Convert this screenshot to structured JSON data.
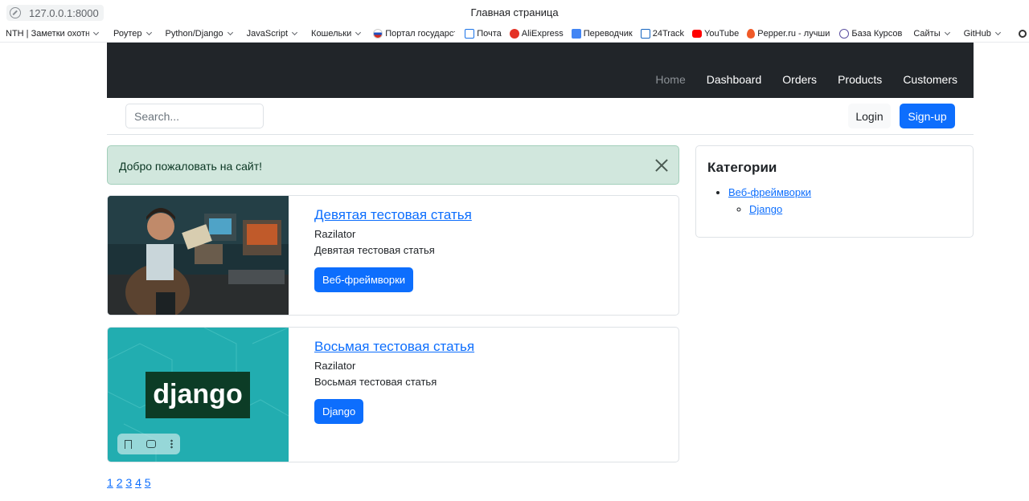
{
  "browser": {
    "address": "127.0.0.1:8000",
    "window_title": "Главная страница",
    "bookmarks": [
      {
        "label": "NTH | Заметки охотн",
        "dropdown": true,
        "color": ""
      },
      {
        "label": "Роутер",
        "dropdown": true,
        "color": ""
      },
      {
        "label": "Python/Django",
        "dropdown": true,
        "color": ""
      },
      {
        "label": "JavaScript",
        "dropdown": true,
        "color": ""
      },
      {
        "label": "Кошельки",
        "dropdown": true,
        "color": ""
      },
      {
        "label": "Портал государст",
        "dropdown": false,
        "color": "#1f4fbf"
      },
      {
        "label": "Почта",
        "dropdown": false,
        "color": "#1a73e8"
      },
      {
        "label": "AliExpress",
        "dropdown": false,
        "color": "#e43225"
      },
      {
        "label": "Переводчик",
        "dropdown": false,
        "color": "#4285f4"
      },
      {
        "label": "24Track",
        "dropdown": false,
        "color": "#1565c0"
      },
      {
        "label": "YouTube",
        "dropdown": false,
        "color": "#ff0000"
      },
      {
        "label": "Pepper.ru - лучши",
        "dropdown": false,
        "color": "#f05a28"
      },
      {
        "label": "База Курсов",
        "dropdown": false,
        "color": "#5b4fa0"
      },
      {
        "label": "Сайты",
        "dropdown": true,
        "color": ""
      },
      {
        "label": "GitHub",
        "dropdown": true,
        "color": ""
      }
    ]
  },
  "navbar": {
    "links": [
      "Home",
      "Dashboard",
      "Orders",
      "Products",
      "Customers"
    ],
    "bg_color": "#212529"
  },
  "search": {
    "placeholder": "Search..."
  },
  "auth": {
    "login": "Login",
    "signup": "Sign-up"
  },
  "alert": {
    "message": "Добро пожаловать на сайт!"
  },
  "posts": [
    {
      "title": "Девятая тестовая статья",
      "author": "Razilator",
      "text": "Девятая тестовая статья",
      "category": "Веб-фреймворки"
    },
    {
      "title": "Восьмая тестовая статья",
      "author": "Razilator",
      "text": "Восьмая тестовая статья",
      "category": "Django",
      "image_logo": "django"
    }
  ],
  "pagination": {
    "pages": [
      "1",
      "2",
      "3",
      "4",
      "5"
    ]
  },
  "sidebar": {
    "heading": "Категории",
    "categories": [
      {
        "label": "Веб-фреймворки",
        "children": [
          {
            "label": "Django"
          }
        ]
      }
    ]
  },
  "colors": {
    "primary": "#0d6efd",
    "alert_bg": "#d1e7dd",
    "django_teal": "#22adb0",
    "django_dark": "#0c3c26"
  }
}
